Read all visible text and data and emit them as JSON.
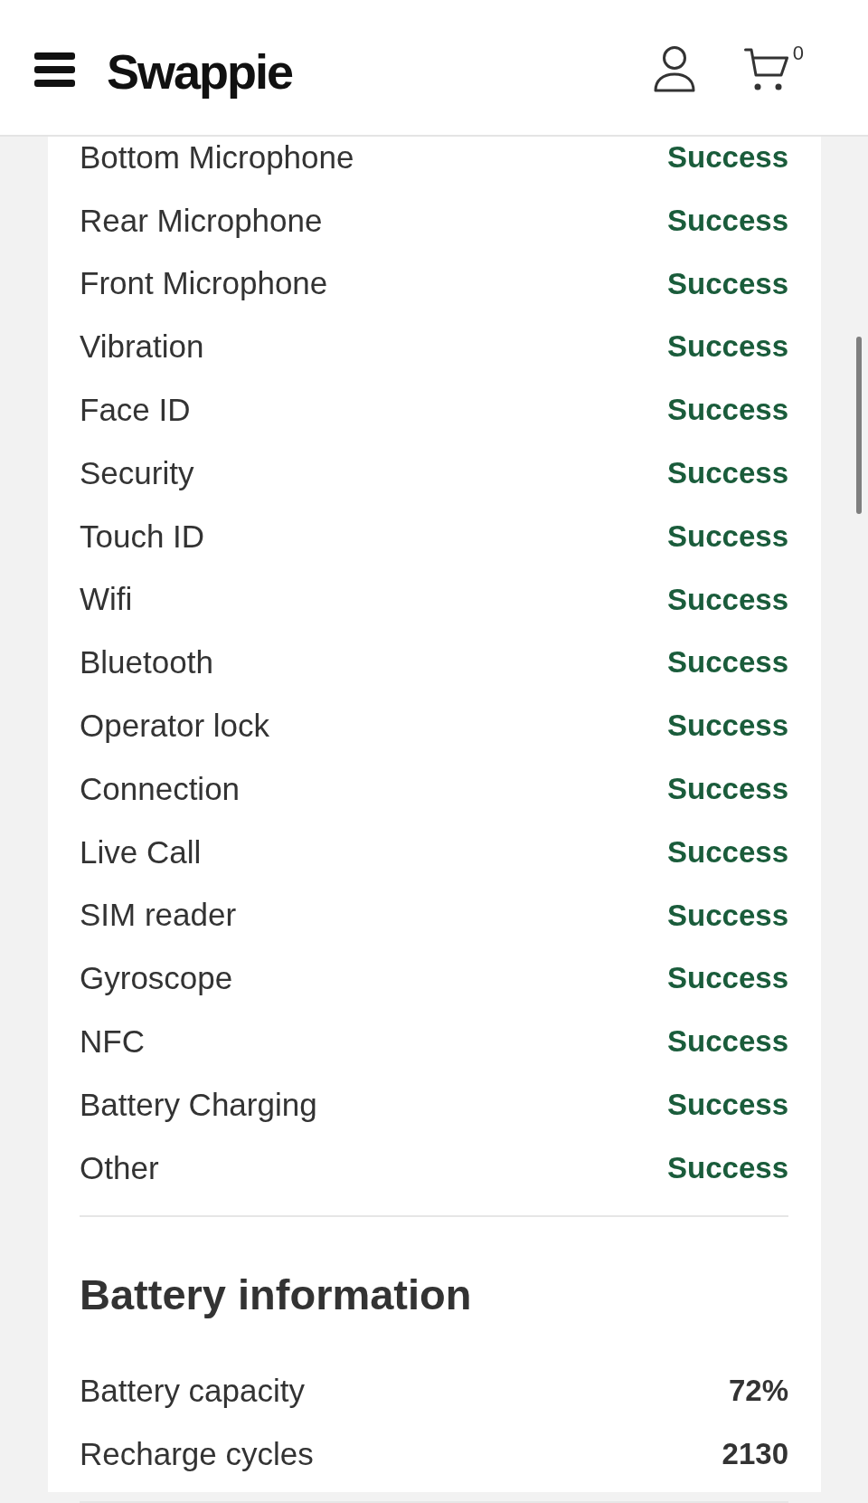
{
  "header": {
    "logo": "Swappie",
    "cart_count": "0"
  },
  "tests": [
    {
      "name": "Bottom Microphone",
      "result": "Success"
    },
    {
      "name": "Rear Microphone",
      "result": "Success"
    },
    {
      "name": "Front Microphone",
      "result": "Success"
    },
    {
      "name": "Vibration",
      "result": "Success"
    },
    {
      "name": "Face ID",
      "result": "Success"
    },
    {
      "name": "Security",
      "result": "Success"
    },
    {
      "name": "Touch ID",
      "result": "Success"
    },
    {
      "name": "Wifi",
      "result": "Success"
    },
    {
      "name": "Bluetooth",
      "result": "Success"
    },
    {
      "name": "Operator lock",
      "result": "Success"
    },
    {
      "name": "Connection",
      "result": "Success"
    },
    {
      "name": "Live Call",
      "result": "Success"
    },
    {
      "name": "SIM reader",
      "result": "Success"
    },
    {
      "name": "Gyroscope",
      "result": "Success"
    },
    {
      "name": "NFC",
      "result": "Success"
    },
    {
      "name": "Battery Charging",
      "result": "Success"
    },
    {
      "name": "Other",
      "result": "Success"
    }
  ],
  "battery": {
    "title": "Battery information",
    "rows": [
      {
        "label": "Battery capacity",
        "value": "72%"
      },
      {
        "label": "Recharge cycles",
        "value": "2130"
      }
    ]
  }
}
